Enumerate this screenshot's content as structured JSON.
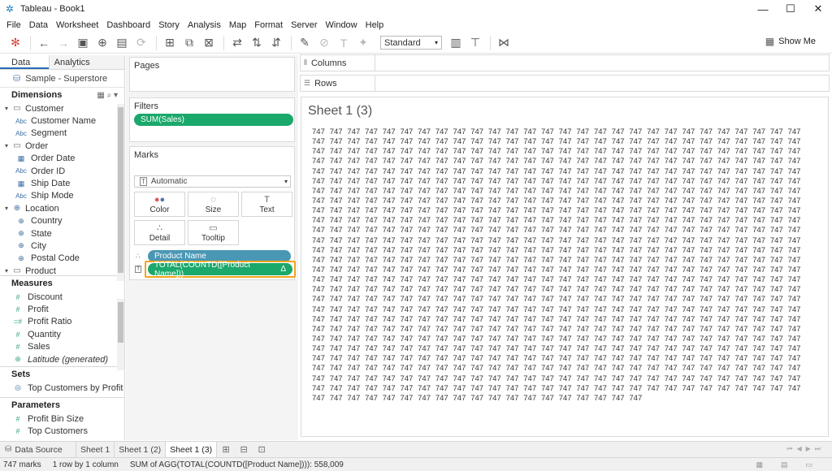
{
  "window": {
    "title": "Tableau - Book1",
    "controls": [
      "—",
      "☐",
      "✕"
    ]
  },
  "menu": [
    "File",
    "Data",
    "Worksheet",
    "Dashboard",
    "Story",
    "Analysis",
    "Map",
    "Format",
    "Server",
    "Window",
    "Help"
  ],
  "toolbar": {
    "fit_value": "Standard",
    "show_me": "Show Me"
  },
  "data_pane": {
    "tabs": [
      "Data",
      "Analytics"
    ],
    "source": "Sample - Superstore",
    "dimensions_header": "Dimensions",
    "dimension_items": [
      {
        "kind": "folder",
        "label": "Customer"
      },
      {
        "kind": "abc",
        "label": "Customer Name"
      },
      {
        "kind": "abc",
        "label": "Segment"
      },
      {
        "kind": "folder",
        "label": "Order"
      },
      {
        "kind": "date",
        "label": "Order Date"
      },
      {
        "kind": "abc",
        "label": "Order ID"
      },
      {
        "kind": "date",
        "label": "Ship Date"
      },
      {
        "kind": "abc",
        "label": "Ship Mode"
      },
      {
        "kind": "geo-folder",
        "label": "Location"
      },
      {
        "kind": "geo",
        "label": "Country"
      },
      {
        "kind": "geo",
        "label": "State"
      },
      {
        "kind": "geo",
        "label": "City"
      },
      {
        "kind": "geo",
        "label": "Postal Code"
      },
      {
        "kind": "folder",
        "label": "Product"
      }
    ],
    "measures_header": "Measures",
    "measure_items": [
      {
        "label": "Discount",
        "italic": false
      },
      {
        "label": "Profit",
        "italic": false
      },
      {
        "label": "Profit Ratio",
        "italic": false
      },
      {
        "label": "Quantity",
        "italic": false
      },
      {
        "label": "Sales",
        "italic": false
      },
      {
        "label": "Latitude (generated)",
        "italic": true
      }
    ],
    "sets_header": "Sets",
    "sets_items": [
      "Top Customers by Profit"
    ],
    "parameters_header": "Parameters",
    "parameter_items": [
      "Profit Bin Size",
      "Top Customers"
    ]
  },
  "shelves": {
    "pages": "Pages",
    "filters": "Filters",
    "filter_pill": "SUM(Sales)",
    "marks": "Marks",
    "mark_type": "Automatic",
    "mark_buttons": [
      "Color",
      "Size",
      "Text",
      "Detail",
      "Tooltip"
    ],
    "detail_pill": "Product Name",
    "text_pill": "TOTAL(COUNTD([Product Name]))",
    "text_pill_delta": "Δ",
    "columns": "Columns",
    "rows": "Rows"
  },
  "view": {
    "title": "Sheet 1 (3)",
    "value": "747",
    "full_rows": 27,
    "per_row": 28,
    "last_row": 19
  },
  "sheet_tabs": [
    "Data Source",
    "Sheet 1",
    "Sheet 1 (2)",
    "Sheet 1 (3)"
  ],
  "status": {
    "marks": "747 marks",
    "dims": "1 row by 1 column",
    "agg": "SUM of AGG(TOTAL(COUNTD([Product Name]))): 558,009"
  },
  "colors": {
    "green_pill": "#1aa86b",
    "blue_pill": "#4a97b5",
    "highlight": "#f3a31b"
  }
}
